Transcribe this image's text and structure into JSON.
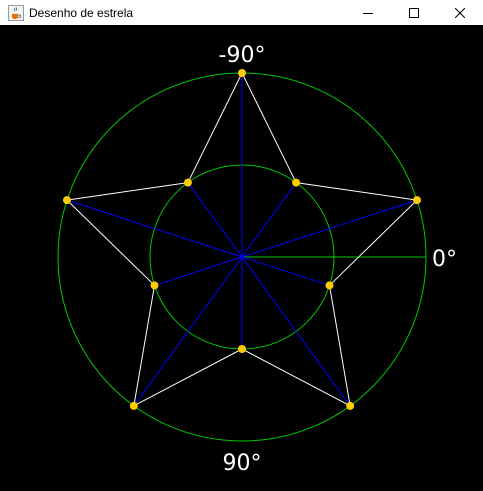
{
  "window": {
    "title": "Desenho de estrela",
    "app_icon": "java-cup-icon",
    "controls": [
      "minimize-icon",
      "maximize-icon",
      "close-icon"
    ]
  },
  "drawing": {
    "background": "#000000",
    "labels": {
      "top": "-90°",
      "right": "0°",
      "bottom": "90°"
    },
    "star_points": 5,
    "colors": {
      "circles": "#00c800",
      "spokes": "#0000ff",
      "star_edges": "#ffffff",
      "vertices": "#ffcc00",
      "reference_line": "#00c800"
    }
  }
}
